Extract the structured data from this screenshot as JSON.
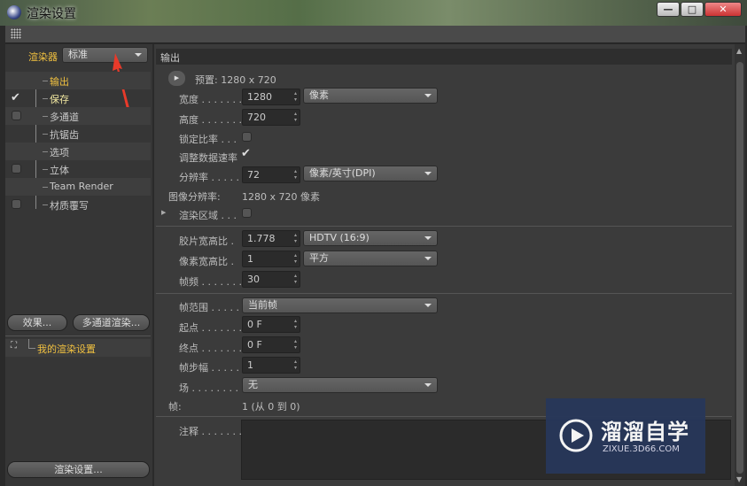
{
  "window": {
    "title": "渲染设置",
    "controls": [
      "—",
      "□",
      "✕"
    ]
  },
  "left": {
    "renderer_label": "渲染器",
    "renderer_value": "标准",
    "items": [
      {
        "label": "输出",
        "checkbox": "none",
        "active": true
      },
      {
        "label": "保存",
        "checkbox": "checked"
      },
      {
        "label": "多通道",
        "checkbox": "unchecked"
      },
      {
        "label": "抗锯齿",
        "checkbox": "none"
      },
      {
        "label": "选项",
        "checkbox": "none"
      },
      {
        "label": "立体",
        "checkbox": "unchecked"
      },
      {
        "label": "Team Render",
        "checkbox": "none"
      },
      {
        "label": "材质覆写",
        "checkbox": "unchecked"
      }
    ],
    "effects_button": "效果...",
    "multipass_button": "多通道渲染...",
    "setting_name": "我的渲染设置",
    "render_settings_button": "渲染设置..."
  },
  "main": {
    "section_title": "输出",
    "preset": "预置: 1280 x 720",
    "width_label": "宽度 . . . . . . .",
    "width": "1280",
    "width_unit": "像素",
    "height_label": "高度 . . . . . . .",
    "height": "720",
    "lock_ratio_label": "锁定比率 . . .",
    "adjust_rate_label": "调整数据速率",
    "resolution_label": "分辨率 . . . . .",
    "resolution": "72",
    "resolution_unit": "像素/英寸(DPI)",
    "image_res_label": "图像分辨率:",
    "image_res": "1280 x 720 像素",
    "render_region_label": "渲染区域 . . .",
    "film_aspect_label": "胶片宽高比 .",
    "film_aspect": "1.778",
    "film_aspect_preset": "HDTV (16:9)",
    "pixel_aspect_label": "像素宽高比 .",
    "pixel_aspect": "1",
    "pixel_aspect_preset": "平方",
    "fps_label": "帧频 . . . . . . .",
    "fps": "30",
    "frame_range_label": "帧范围 . . . . .",
    "frame_range": "当前帧",
    "from_label": "起点 . . . . . . .",
    "from": "0 F",
    "to_label": "终点 . . . . . . .",
    "to": "0 F",
    "step_label": "帧步幅 . . . . .",
    "step": "1",
    "field_label": "场 . . . . . . . . .",
    "field": "无",
    "frames_label": "帧:",
    "frames": "1 (从 0 到 0)",
    "notes_label": "注释 . . . . . . ."
  },
  "watermark": {
    "name": "溜溜自学",
    "url": "ZIXUE.3D66.COM"
  }
}
